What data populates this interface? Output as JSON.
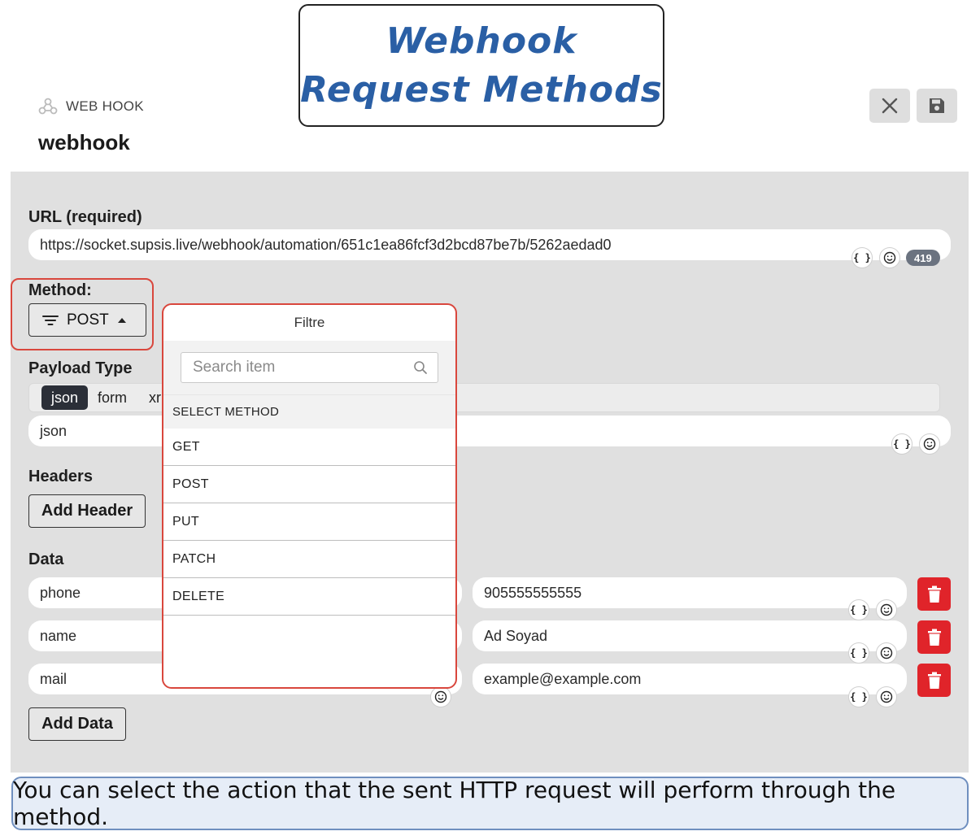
{
  "annotation": {
    "title": "Webhook Request Methods",
    "caption": "You can select the action that the sent HTTP request will perform through the method."
  },
  "header": {
    "type_label": "WEB HOOK",
    "name": "webhook"
  },
  "url": {
    "label": "URL (required)",
    "value": "https://socket.supsis.live/webhook/automation/651c1ea86fcf3d2bcd87be7b/5262aedad0",
    "char_count": "419"
  },
  "method": {
    "label": "Method:",
    "selected": "POST"
  },
  "payload": {
    "label": "Payload Type",
    "options": [
      "json",
      "form",
      "xr"
    ],
    "value": "json"
  },
  "headers": {
    "label": "Headers",
    "add_label": "Add Header"
  },
  "data": {
    "label": "Data",
    "rows": [
      {
        "key": "phone",
        "value": "905555555555"
      },
      {
        "key": "name",
        "value": "Ad Soyad"
      },
      {
        "key": "mail",
        "value": "example@example.com"
      }
    ],
    "add_label": "Add Data"
  },
  "dropdown": {
    "title": "Filtre",
    "search_placeholder": "Search item",
    "section": "SELECT METHOD",
    "items": [
      "GET",
      "POST",
      "PUT",
      "PATCH",
      "DELETE"
    ]
  },
  "colors": {
    "highlight": "#d9473d",
    "delete": "#e0242a",
    "title_text": "#2a5fa5"
  }
}
